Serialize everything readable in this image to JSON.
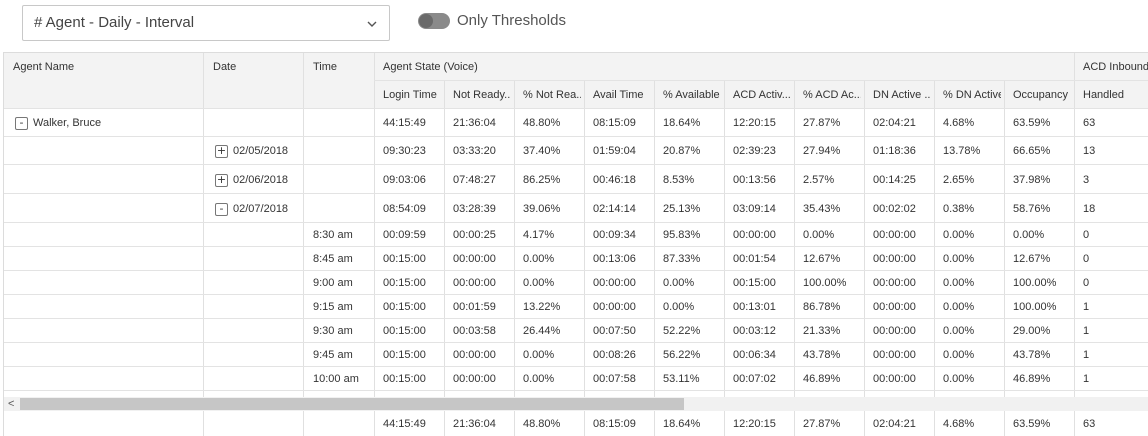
{
  "toolbar": {
    "report_select_value": "# Agent - Daily - Interval",
    "thresholds_label": "Only Thresholds"
  },
  "table": {
    "col_agent_name": "Agent Name",
    "col_date": "Date",
    "col_time": "Time",
    "group_agent_state": "Agent State (Voice)",
    "group_acd_inbound": "ACD Inbound",
    "sub_columns": [
      "Login Time",
      "Not Ready...",
      "% Not Rea...",
      "Avail Time",
      "% Available",
      "ACD Activ...",
      "% ACD Ac...",
      "DN Active ...",
      "% DN Active",
      "Occupancy",
      "Handled"
    ],
    "rows": [
      {
        "kind": "agent",
        "expander": "-",
        "name": "Walker, Bruce",
        "date": "",
        "time": "",
        "values": [
          "44:15:49",
          "21:36:04",
          "48.80%",
          "08:15:09",
          "18.64%",
          "12:20:15",
          "27.87%",
          "02:04:21",
          "4.68%",
          "63.59%",
          "63"
        ]
      },
      {
        "kind": "date",
        "expander": "+",
        "name": "",
        "date": "02/05/2018",
        "time": "",
        "values": [
          "09:30:23",
          "03:33:20",
          "37.40%",
          "01:59:04",
          "20.87%",
          "02:39:23",
          "27.94%",
          "01:18:36",
          "13.78%",
          "66.65%",
          "13"
        ]
      },
      {
        "kind": "date",
        "expander": "+",
        "name": "",
        "date": "02/06/2018",
        "time": "",
        "values": [
          "09:03:06",
          "07:48:27",
          "86.25%",
          "00:46:18",
          "8.53%",
          "00:13:56",
          "2.57%",
          "00:14:25",
          "2.65%",
          "37.98%",
          "3"
        ]
      },
      {
        "kind": "date",
        "expander": "-",
        "name": "",
        "date": "02/07/2018",
        "time": "",
        "values": [
          "08:54:09",
          "03:28:39",
          "39.06%",
          "02:14:14",
          "25.13%",
          "03:09:14",
          "35.43%",
          "00:02:02",
          "0.38%",
          "58.76%",
          "18"
        ]
      },
      {
        "kind": "interval",
        "expander": "",
        "name": "",
        "date": "",
        "time": "8:30 am",
        "values": [
          "00:09:59",
          "00:00:25",
          "4.17%",
          "00:09:34",
          "95.83%",
          "00:00:00",
          "0.00%",
          "00:00:00",
          "0.00%",
          "0.00%",
          "0"
        ]
      },
      {
        "kind": "interval",
        "expander": "",
        "name": "",
        "date": "",
        "time": "8:45 am",
        "values": [
          "00:15:00",
          "00:00:00",
          "0.00%",
          "00:13:06",
          "87.33%",
          "00:01:54",
          "12.67%",
          "00:00:00",
          "0.00%",
          "12.67%",
          "0"
        ]
      },
      {
        "kind": "interval",
        "expander": "",
        "name": "",
        "date": "",
        "time": "9:00 am",
        "values": [
          "00:15:00",
          "00:00:00",
          "0.00%",
          "00:00:00",
          "0.00%",
          "00:15:00",
          "100.00%",
          "00:00:00",
          "0.00%",
          "100.00%",
          "0"
        ]
      },
      {
        "kind": "interval",
        "expander": "",
        "name": "",
        "date": "",
        "time": "9:15 am",
        "values": [
          "00:15:00",
          "00:01:59",
          "13.22%",
          "00:00:00",
          "0.00%",
          "00:13:01",
          "86.78%",
          "00:00:00",
          "0.00%",
          "100.00%",
          "1"
        ]
      },
      {
        "kind": "interval",
        "expander": "",
        "name": "",
        "date": "",
        "time": "9:30 am",
        "values": [
          "00:15:00",
          "00:03:58",
          "26.44%",
          "00:07:50",
          "52.22%",
          "00:03:12",
          "21.33%",
          "00:00:00",
          "0.00%",
          "29.00%",
          "1"
        ]
      },
      {
        "kind": "interval",
        "expander": "",
        "name": "",
        "date": "",
        "time": "9:45 am",
        "values": [
          "00:15:00",
          "00:00:00",
          "0.00%",
          "00:08:26",
          "56.22%",
          "00:06:34",
          "43.78%",
          "00:00:00",
          "0.00%",
          "43.78%",
          "1"
        ]
      },
      {
        "kind": "interval",
        "expander": "",
        "name": "",
        "date": "",
        "time": "10:00 am",
        "values": [
          "00:15:00",
          "00:00:00",
          "0.00%",
          "00:07:58",
          "53.11%",
          "00:07:02",
          "46.89%",
          "00:00:00",
          "0.00%",
          "46.89%",
          "1"
        ]
      }
    ],
    "totals": [
      "44:15:49",
      "21:36:04",
      "48.80%",
      "08:15:09",
      "18.64%",
      "12:20:15",
      "27.87%",
      "02:04:21",
      "4.68%",
      "63.59%",
      "63"
    ]
  },
  "scrollbar": {
    "left_arrow": "<"
  },
  "colors": {
    "header_bg": "#f3f3f3",
    "grid_line": "#e0e0e0",
    "toggle_off": "#8a8a8a"
  }
}
